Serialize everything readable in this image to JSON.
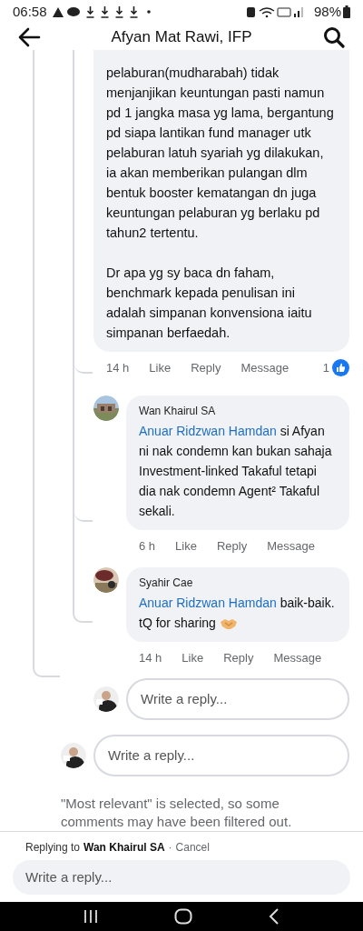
{
  "status_bar": {
    "time": "06:58",
    "battery": "98%"
  },
  "header": {
    "title": "Afyan Mat Rawi, IFP"
  },
  "comment": {
    "text": "pelaburan(mudharabah)  tidak menjanjikan keuntungan pasti namun pd 1 jangka masa yg lama, bergantung pd siapa lantikan fund manager utk pelaburan latuh syariah yg dilakukan, ia akan memberikan pulangan dlm bentuk booster kematangan dn juga keuntungan pelaburan yg berlaku pd tahun2 tertentu.\n\nDr apa yg sy baca dn faham, benchmark kepada penulisan ini adalah simpanan konvensiona iaitu simpanan berfaedah.",
    "time": "14 h",
    "actions": [
      "Like",
      "Reply",
      "Message"
    ],
    "like_count": "1"
  },
  "replies": [
    {
      "author": "Wan Khairul SA",
      "mention": "Anuar Ridzwan Hamdan",
      "text": " si Afyan ni nak condemn kan bukan sahaja Investment-linked Takaful tetapi dia nak condemn Agent² Takaful sekali.",
      "emoji": false,
      "time": "6 h",
      "actions": [
        "Like",
        "Reply",
        "Message"
      ]
    },
    {
      "author": "Syahir Cae",
      "mention": "Anuar Ridzwan Hamdan",
      "text": " baik-baik. tQ for sharing",
      "emoji": true,
      "time": "14 h",
      "actions": [
        "Like",
        "Reply",
        "Message"
      ]
    }
  ],
  "inline_reply_fields": [
    {
      "placeholder": "Write a reply..."
    },
    {
      "placeholder": "Write a reply..."
    }
  ],
  "filter_note": "\"Most relevant\" is selected, so some comments may have been filtered out.",
  "composer": {
    "replying_prefix": "Replying to",
    "replying_name": "Wan Khairul SA",
    "separator": "·",
    "cancel": "Cancel",
    "placeholder": "Write a reply..."
  }
}
